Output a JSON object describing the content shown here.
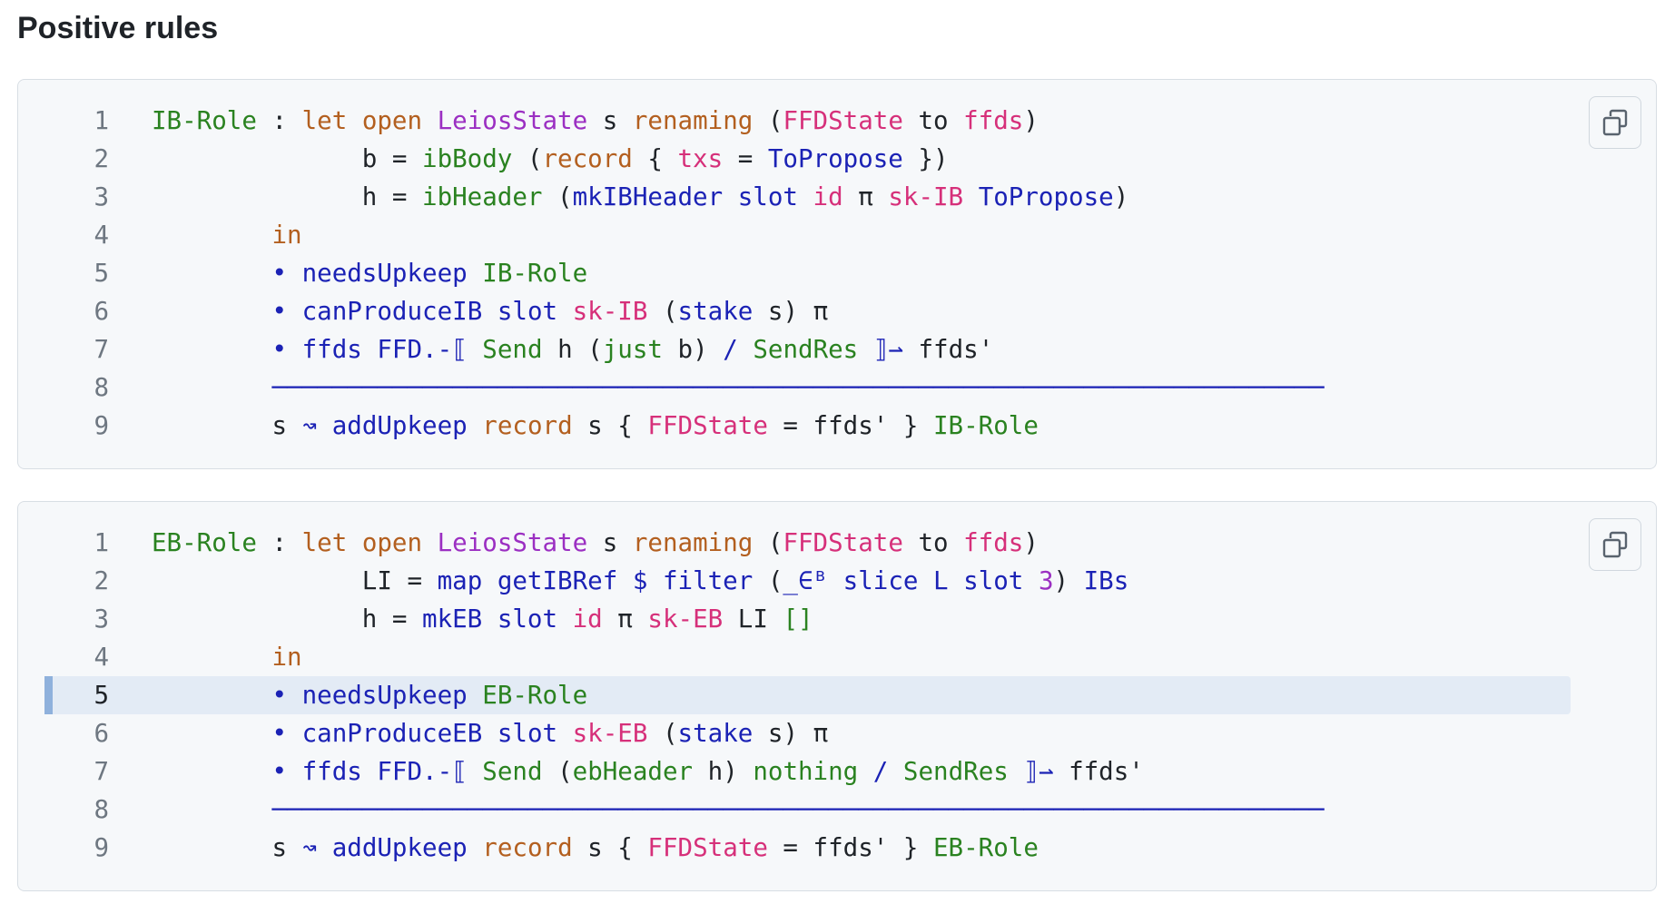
{
  "page": {
    "section_title": "Positive rules"
  },
  "icons": {
    "copy": "copy-icon"
  },
  "colors": {
    "keyword": "#b35f1f",
    "function": "#1b22b5",
    "constructor": "#2a8220",
    "field": "#d6307a",
    "module": "#9b2fc2",
    "number": "#9b2fc2",
    "plain": "#1f2328",
    "line_number": "#6e7781",
    "block_background": "#f6f8fa",
    "highlight_background": "#e3ebf5",
    "highlight_marker": "#8fb1dc"
  },
  "code_blocks": [
    {
      "lines": [
        {
          "number": "1",
          "tokens": [
            {
              "t": "IB-Role",
              "c": "con"
            },
            {
              "t": " : ",
              "c": "plain"
            },
            {
              "t": "let",
              "c": "kw"
            },
            {
              "t": " ",
              "c": "plain"
            },
            {
              "t": "open",
              "c": "kw"
            },
            {
              "t": " ",
              "c": "plain"
            },
            {
              "t": "LeiosState",
              "c": "mod"
            },
            {
              "t": " s ",
              "c": "plain"
            },
            {
              "t": "renaming",
              "c": "kw"
            },
            {
              "t": " (",
              "c": "plain"
            },
            {
              "t": "FFDState",
              "c": "field"
            },
            {
              "t": " to ",
              "c": "plain"
            },
            {
              "t": "ffds",
              "c": "field"
            },
            {
              "t": ")",
              "c": "plain"
            }
          ]
        },
        {
          "number": "2",
          "tokens": [
            {
              "t": "              b = ",
              "c": "plain"
            },
            {
              "t": "ibBody",
              "c": "con"
            },
            {
              "t": " (",
              "c": "plain"
            },
            {
              "t": "record",
              "c": "kw"
            },
            {
              "t": " { ",
              "c": "plain"
            },
            {
              "t": "txs",
              "c": "field"
            },
            {
              "t": " = ",
              "c": "plain"
            },
            {
              "t": "ToPropose",
              "c": "fn"
            },
            {
              "t": " })",
              "c": "plain"
            }
          ]
        },
        {
          "number": "3",
          "tokens": [
            {
              "t": "              h = ",
              "c": "plain"
            },
            {
              "t": "ibHeader",
              "c": "con"
            },
            {
              "t": " (",
              "c": "plain"
            },
            {
              "t": "mkIBHeader",
              "c": "fn"
            },
            {
              "t": " ",
              "c": "plain"
            },
            {
              "t": "slot",
              "c": "fn"
            },
            {
              "t": " ",
              "c": "plain"
            },
            {
              "t": "id",
              "c": "field"
            },
            {
              "t": " π ",
              "c": "plain"
            },
            {
              "t": "sk-IB",
              "c": "field"
            },
            {
              "t": " ",
              "c": "plain"
            },
            {
              "t": "ToPropose",
              "c": "fn"
            },
            {
              "t": ")",
              "c": "plain"
            }
          ]
        },
        {
          "number": "4",
          "tokens": [
            {
              "t": "        ",
              "c": "plain"
            },
            {
              "t": "in",
              "c": "kw"
            }
          ]
        },
        {
          "number": "5",
          "tokens": [
            {
              "t": "        ",
              "c": "plain"
            },
            {
              "t": "•",
              "c": "fn"
            },
            {
              "t": " ",
              "c": "plain"
            },
            {
              "t": "needsUpkeep",
              "c": "fn"
            },
            {
              "t": " ",
              "c": "plain"
            },
            {
              "t": "IB-Role",
              "c": "con"
            }
          ]
        },
        {
          "number": "6",
          "tokens": [
            {
              "t": "        ",
              "c": "plain"
            },
            {
              "t": "•",
              "c": "fn"
            },
            {
              "t": " ",
              "c": "plain"
            },
            {
              "t": "canProduceIB",
              "c": "fn"
            },
            {
              "t": " ",
              "c": "plain"
            },
            {
              "t": "slot",
              "c": "fn"
            },
            {
              "t": " ",
              "c": "plain"
            },
            {
              "t": "sk-IB",
              "c": "field"
            },
            {
              "t": " (",
              "c": "plain"
            },
            {
              "t": "stake",
              "c": "fn"
            },
            {
              "t": " s) π",
              "c": "plain"
            }
          ]
        },
        {
          "number": "7",
          "tokens": [
            {
              "t": "        ",
              "c": "plain"
            },
            {
              "t": "•",
              "c": "fn"
            },
            {
              "t": " ",
              "c": "plain"
            },
            {
              "t": "ffds",
              "c": "fn"
            },
            {
              "t": " ",
              "c": "plain"
            },
            {
              "t": "FFD.-⟦",
              "c": "fn"
            },
            {
              "t": " ",
              "c": "plain"
            },
            {
              "t": "Send",
              "c": "con"
            },
            {
              "t": " h (",
              "c": "plain"
            },
            {
              "t": "just",
              "c": "con"
            },
            {
              "t": " b) ",
              "c": "plain"
            },
            {
              "t": "/",
              "c": "fn"
            },
            {
              "t": " ",
              "c": "plain"
            },
            {
              "t": "SendRes",
              "c": "con"
            },
            {
              "t": " ",
              "c": "plain"
            },
            {
              "t": "⟧⇀",
              "c": "fn"
            },
            {
              "t": " ffds'",
              "c": "plain"
            }
          ]
        },
        {
          "number": "8",
          "tokens": [
            {
              "t": "        ",
              "c": "plain"
            },
            {
              "t": "──────────────────────────────────────────────────────────────────────",
              "c": "fn"
            }
          ]
        },
        {
          "number": "9",
          "tokens": [
            {
              "t": "        s ",
              "c": "plain"
            },
            {
              "t": "↝",
              "c": "fn"
            },
            {
              "t": " ",
              "c": "plain"
            },
            {
              "t": "addUpkeep",
              "c": "fn"
            },
            {
              "t": " ",
              "c": "plain"
            },
            {
              "t": "record",
              "c": "kw"
            },
            {
              "t": " s { ",
              "c": "plain"
            },
            {
              "t": "FFDState",
              "c": "field"
            },
            {
              "t": " = ffds' } ",
              "c": "plain"
            },
            {
              "t": "IB-Role",
              "c": "con"
            }
          ]
        }
      ]
    },
    {
      "lines": [
        {
          "number": "1",
          "tokens": [
            {
              "t": "EB-Role",
              "c": "con"
            },
            {
              "t": " : ",
              "c": "plain"
            },
            {
              "t": "let",
              "c": "kw"
            },
            {
              "t": " ",
              "c": "plain"
            },
            {
              "t": "open",
              "c": "kw"
            },
            {
              "t": " ",
              "c": "plain"
            },
            {
              "t": "LeiosState",
              "c": "mod"
            },
            {
              "t": " s ",
              "c": "plain"
            },
            {
              "t": "renaming",
              "c": "kw"
            },
            {
              "t": " (",
              "c": "plain"
            },
            {
              "t": "FFDState",
              "c": "field"
            },
            {
              "t": " to ",
              "c": "plain"
            },
            {
              "t": "ffds",
              "c": "field"
            },
            {
              "t": ")",
              "c": "plain"
            }
          ]
        },
        {
          "number": "2",
          "tokens": [
            {
              "t": "              LI = ",
              "c": "plain"
            },
            {
              "t": "map",
              "c": "fn"
            },
            {
              "t": " ",
              "c": "plain"
            },
            {
              "t": "getIBRef",
              "c": "fn"
            },
            {
              "t": " ",
              "c": "plain"
            },
            {
              "t": "$",
              "c": "fn"
            },
            {
              "t": " ",
              "c": "plain"
            },
            {
              "t": "filter",
              "c": "fn"
            },
            {
              "t": " (",
              "c": "plain"
            },
            {
              "t": "_∈ᴮ",
              "c": "fn"
            },
            {
              "t": " ",
              "c": "plain"
            },
            {
              "t": "slice",
              "c": "fn"
            },
            {
              "t": " ",
              "c": "plain"
            },
            {
              "t": "L",
              "c": "fn"
            },
            {
              "t": " ",
              "c": "plain"
            },
            {
              "t": "slot",
              "c": "fn"
            },
            {
              "t": " ",
              "c": "plain"
            },
            {
              "t": "3",
              "c": "num"
            },
            {
              "t": ") ",
              "c": "plain"
            },
            {
              "t": "IBs",
              "c": "fn"
            }
          ]
        },
        {
          "number": "3",
          "tokens": [
            {
              "t": "              h = ",
              "c": "plain"
            },
            {
              "t": "mkEB",
              "c": "fn"
            },
            {
              "t": " ",
              "c": "plain"
            },
            {
              "t": "slot",
              "c": "fn"
            },
            {
              "t": " ",
              "c": "plain"
            },
            {
              "t": "id",
              "c": "field"
            },
            {
              "t": " π ",
              "c": "plain"
            },
            {
              "t": "sk-EB",
              "c": "field"
            },
            {
              "t": " LI ",
              "c": "plain"
            },
            {
              "t": "[]",
              "c": "con"
            }
          ]
        },
        {
          "number": "4",
          "tokens": [
            {
              "t": "        ",
              "c": "plain"
            },
            {
              "t": "in",
              "c": "kw"
            }
          ]
        },
        {
          "number": "5",
          "highlighted": true,
          "tokens": [
            {
              "t": "        ",
              "c": "plain"
            },
            {
              "t": "•",
              "c": "fn"
            },
            {
              "t": " ",
              "c": "plain"
            },
            {
              "t": "needsUpkeep",
              "c": "fn"
            },
            {
              "t": " ",
              "c": "plain"
            },
            {
              "t": "EB-Role",
              "c": "con"
            }
          ]
        },
        {
          "number": "6",
          "tokens": [
            {
              "t": "        ",
              "c": "plain"
            },
            {
              "t": "•",
              "c": "fn"
            },
            {
              "t": " ",
              "c": "plain"
            },
            {
              "t": "canProduceEB",
              "c": "fn"
            },
            {
              "t": " ",
              "c": "plain"
            },
            {
              "t": "slot",
              "c": "fn"
            },
            {
              "t": " ",
              "c": "plain"
            },
            {
              "t": "sk-EB",
              "c": "field"
            },
            {
              "t": " (",
              "c": "plain"
            },
            {
              "t": "stake",
              "c": "fn"
            },
            {
              "t": " s) π",
              "c": "plain"
            }
          ]
        },
        {
          "number": "7",
          "tokens": [
            {
              "t": "        ",
              "c": "plain"
            },
            {
              "t": "•",
              "c": "fn"
            },
            {
              "t": " ",
              "c": "plain"
            },
            {
              "t": "ffds",
              "c": "fn"
            },
            {
              "t": " ",
              "c": "plain"
            },
            {
              "t": "FFD.-⟦",
              "c": "fn"
            },
            {
              "t": " ",
              "c": "plain"
            },
            {
              "t": "Send",
              "c": "con"
            },
            {
              "t": " (",
              "c": "plain"
            },
            {
              "t": "ebHeader",
              "c": "con"
            },
            {
              "t": " h) ",
              "c": "plain"
            },
            {
              "t": "nothing",
              "c": "con"
            },
            {
              "t": " ",
              "c": "plain"
            },
            {
              "t": "/",
              "c": "fn"
            },
            {
              "t": " ",
              "c": "plain"
            },
            {
              "t": "SendRes",
              "c": "con"
            },
            {
              "t": " ",
              "c": "plain"
            },
            {
              "t": "⟧⇀",
              "c": "fn"
            },
            {
              "t": " ffds'",
              "c": "plain"
            }
          ]
        },
        {
          "number": "8",
          "tokens": [
            {
              "t": "        ",
              "c": "plain"
            },
            {
              "t": "──────────────────────────────────────────────────────────────────────",
              "c": "fn"
            }
          ]
        },
        {
          "number": "9",
          "tokens": [
            {
              "t": "        s ",
              "c": "plain"
            },
            {
              "t": "↝",
              "c": "fn"
            },
            {
              "t": " ",
              "c": "plain"
            },
            {
              "t": "addUpkeep",
              "c": "fn"
            },
            {
              "t": " ",
              "c": "plain"
            },
            {
              "t": "record",
              "c": "kw"
            },
            {
              "t": " s { ",
              "c": "plain"
            },
            {
              "t": "FFDState",
              "c": "field"
            },
            {
              "t": " = ffds' } ",
              "c": "plain"
            },
            {
              "t": "EB-Role",
              "c": "con"
            }
          ]
        }
      ]
    }
  ]
}
